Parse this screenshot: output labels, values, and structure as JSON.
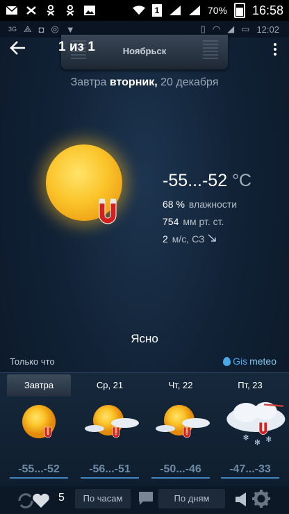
{
  "statusbar": {
    "battery": "70%",
    "time": "16:58",
    "sim": "1"
  },
  "inner_status": {
    "network": "3G",
    "time": "12:02"
  },
  "toolbar": {
    "counter": "1 из 1",
    "city": "Ноябрьск"
  },
  "date": {
    "prefix": "Завтра",
    "weekday": "вторник,",
    "day": "20 декабря"
  },
  "current": {
    "temp": "-55...-52",
    "unit": "°C",
    "humidity_value": "68 %",
    "humidity_label": "влажности",
    "pressure_value": "754",
    "pressure_label": "мм рт. ст.",
    "wind_value": "2",
    "wind_label": "м/с, СЗ",
    "condition": "Ясно"
  },
  "footer": {
    "updated": "Только что",
    "brand_gis": "Gis",
    "brand_meteo": "meteo"
  },
  "forecast": [
    {
      "label": "Завтра",
      "temp": "-55...-52",
      "icon": "sun-icon",
      "active": true
    },
    {
      "label": "Ср, 21",
      "temp": "-56...-51",
      "icon": "sun-cloud-icon",
      "active": false
    },
    {
      "label": "Чт, 22",
      "temp": "-50...-46",
      "icon": "sun-cloud-icon",
      "active": false
    },
    {
      "label": "Пт, 23",
      "temp": "-47...-33",
      "icon": "snow-cloud-icon",
      "active": false
    }
  ],
  "bottom": {
    "likes": "5",
    "hourly": "По часам",
    "daily": "По дням"
  },
  "colors": {
    "accent": "#3f88c4",
    "brand": "#4aa8e6"
  }
}
